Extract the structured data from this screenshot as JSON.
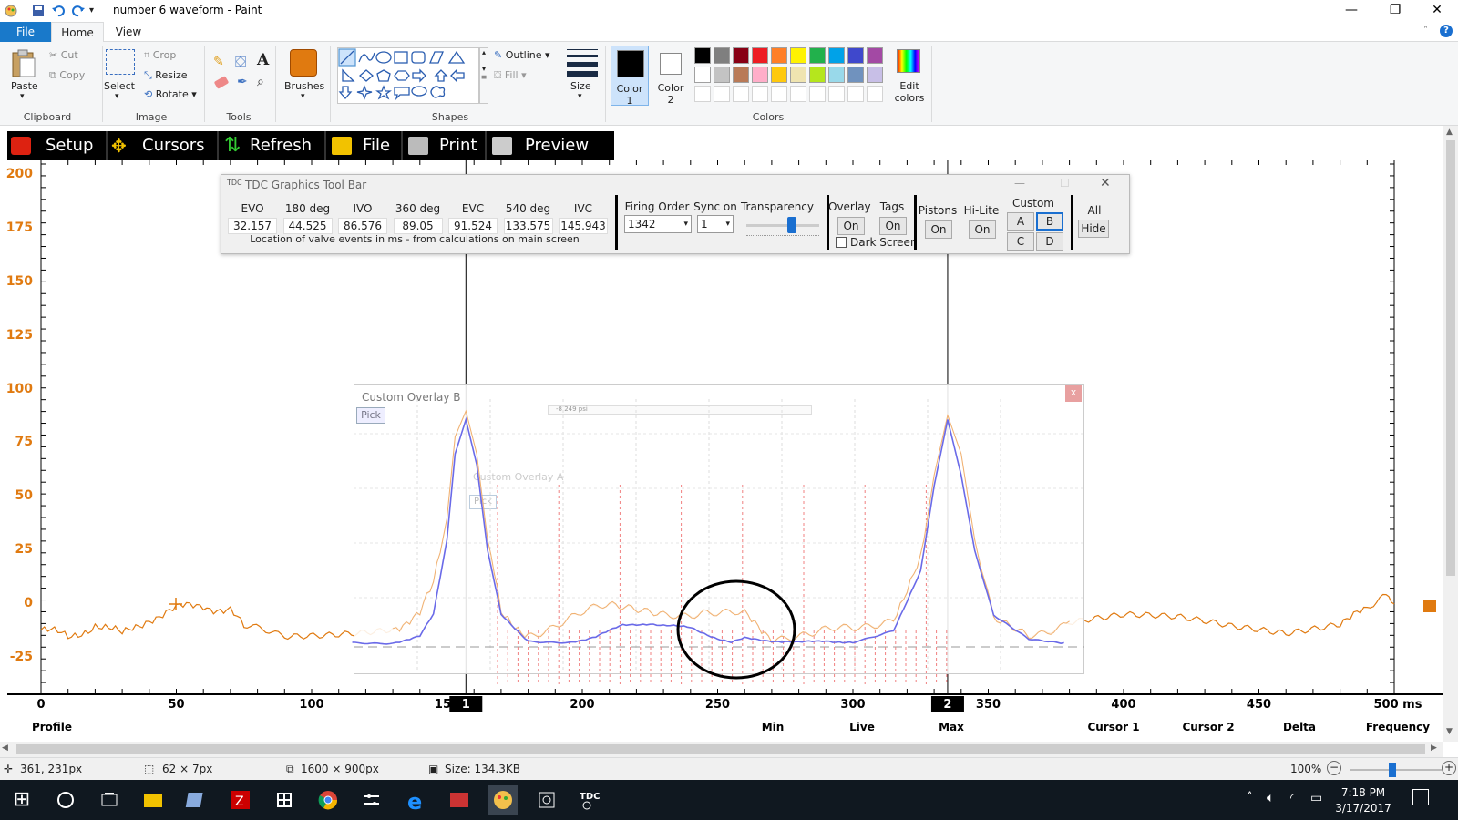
{
  "window": {
    "title": "number 6 waveform - Paint",
    "minimize": "—",
    "restore": "❐",
    "close": "✕"
  },
  "ribbon_tabs": [
    "File",
    "Home",
    "View"
  ],
  "ribbon": {
    "clipboard": {
      "paste": "Paste",
      "cut": "Cut",
      "copy": "Copy",
      "label": "Clipboard"
    },
    "image": {
      "select": "Select",
      "crop": "Crop",
      "resize": "Resize",
      "rotate": "Rotate",
      "label": "Image"
    },
    "tools": {
      "label": "Tools"
    },
    "brushes": {
      "label": "Brushes"
    },
    "shapes": {
      "outline": "Outline",
      "fill": "Fill",
      "label": "Shapes"
    },
    "size": {
      "label": "Size"
    },
    "color1": {
      "line1": "Color",
      "line2": "1"
    },
    "color2": {
      "line1": "Color",
      "line2": "2"
    },
    "edit_colors": {
      "line1": "Edit",
      "line2": "colors"
    },
    "colors_label": "Colors",
    "palette_row1": [
      "#000000",
      "#7f7f7f",
      "#880015",
      "#ed1c24",
      "#ff7f27",
      "#fff200",
      "#22b14c",
      "#00a2e8",
      "#3f48cc",
      "#a349a4"
    ],
    "palette_row2": [
      "#ffffff",
      "#c3c3c3",
      "#b97a57",
      "#ffaec9",
      "#ffc90e",
      "#efe4b0",
      "#b5e61d",
      "#99d9ea",
      "#7092be",
      "#c8bfe7"
    ]
  },
  "tdc_menu": [
    "Setup",
    "Cursors",
    "Refresh",
    "File",
    "Print",
    "Preview"
  ],
  "tdc_toolbar": {
    "title": "TDC Graphics Tool Bar",
    "valve_events": [
      {
        "label": "EVO",
        "value": "32.157"
      },
      {
        "label": "180 deg",
        "value": "44.525"
      },
      {
        "label": "IVO",
        "value": "86.576"
      },
      {
        "label": "360 deg",
        "value": "89.05"
      },
      {
        "label": "EVC",
        "value": "91.524"
      },
      {
        "label": "540 deg",
        "value": "133.575"
      },
      {
        "label": "IVC",
        "value": "145.943"
      }
    ],
    "caption": "Location of valve events in ms - from calculations on main screen",
    "firing_order_label": "Firing Order",
    "firing_order_value": "1342",
    "sync_label": "Sync on",
    "sync_value": "1",
    "transparency_label": "Transparency",
    "transparency_level": 0.62,
    "overlay_label": "Overlay",
    "overlay_btn": "On",
    "tags_label": "Tags",
    "tags_btn": "On",
    "dark_screen_label": "Dark Screen",
    "dark_screen_checked": false,
    "pistons_label": "Pistons",
    "pistons_btn": "On",
    "hilite_label": "Hi-Lite",
    "hilite_btn": "On",
    "custom_label": "Custom",
    "custom_btns": [
      "A",
      "B",
      "C",
      "D"
    ],
    "custom_selected": "B",
    "all_label": "All",
    "hide_btn": "Hide"
  },
  "overlay_b": {
    "title": "Custom Overlay B",
    "pick": "Pick",
    "readout": "-8.249 psi",
    "close": "x"
  },
  "overlay_a": {
    "title": "Custom Overlay A",
    "pick": "Pick"
  },
  "cursor_labels": [
    "1",
    "2"
  ],
  "bottom_labels": [
    "Profile",
    "Min",
    "Live",
    "Max",
    "Cursor 1",
    "Cursor 2",
    "Delta",
    "Frequency"
  ],
  "chart_data": {
    "type": "line",
    "yticks": [
      200,
      175,
      150,
      125,
      100,
      75,
      50,
      25,
      0,
      -25
    ],
    "xticks": [
      "0",
      "50",
      "100",
      "150",
      "200",
      "250",
      "300",
      "350",
      "400",
      "450",
      "500 ms"
    ],
    "xlim": [
      0,
      500
    ],
    "ylim": [
      -30,
      205
    ],
    "cursors_ms": [
      157,
      335
    ],
    "series": [
      {
        "color": "#e07a10",
        "x": [
          0,
          10,
          20,
          30,
          40,
          50,
          60,
          70,
          75,
          90,
          110,
          130,
          140,
          145,
          150,
          153,
          157,
          161,
          165,
          170,
          180,
          195,
          210,
          230,
          245,
          260,
          270,
          285,
          300,
          315,
          325,
          330,
          335,
          340,
          345,
          352,
          365,
          380,
          400,
          420,
          440,
          460,
          480,
          490,
          497,
          500
        ],
        "y": [
          -12,
          -16,
          -9,
          -15,
          -6,
          -3,
          0,
          -3,
          -12,
          -14,
          -12,
          -10,
          -5,
          8,
          40,
          78,
          90,
          70,
          30,
          -5,
          -13,
          -7,
          -2,
          -5,
          -2,
          -6,
          -14,
          -15,
          -12,
          -5,
          20,
          60,
          88,
          70,
          30,
          -5,
          -13,
          -8,
          -6,
          -8,
          -12,
          -14,
          -8,
          -4,
          2,
          0
        ]
      },
      {
        "color": "#6a6ae8",
        "x": [
          115,
          130,
          140,
          145,
          150,
          153,
          157,
          161,
          165,
          170,
          180,
          195,
          205,
          215,
          225,
          230,
          240,
          250,
          255,
          260,
          270,
          280,
          290,
          300,
          315,
          325,
          330,
          335,
          340,
          345,
          352,
          365,
          378
        ],
        "y": [
          -18,
          -18,
          -15,
          -5,
          30,
          70,
          86,
          65,
          25,
          -5,
          -17,
          -18,
          -15,
          -10,
          -9,
          -10,
          -11,
          -16,
          -18,
          -16,
          -17,
          -18,
          -17,
          -18,
          -12,
          15,
          55,
          86,
          60,
          25,
          -5,
          -16,
          -18
        ]
      }
    ]
  },
  "status": {
    "cursor_pos": "361, 231px",
    "selection": "62 × 7px",
    "image_size": "1600 × 900px",
    "file_size": "Size: 134.3KB",
    "zoom": "100%"
  },
  "taskbar": {
    "time": "7:18 PM",
    "date": "3/17/2017"
  }
}
